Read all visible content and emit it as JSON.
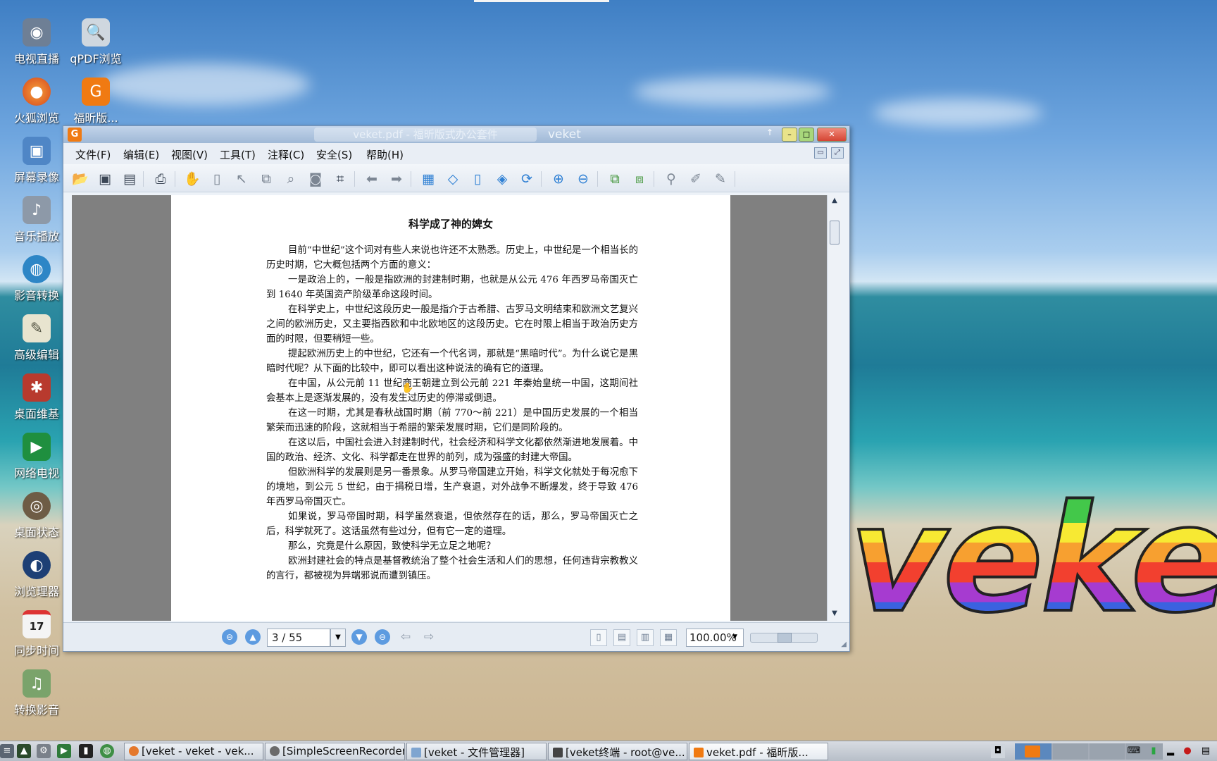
{
  "desktop": {
    "icons": [
      {
        "label": "电视直播",
        "glyph": "◉"
      },
      {
        "label": "qPDF浏览",
        "glyph": "🔍"
      },
      {
        "label": "火狐浏览",
        "glyph": "●"
      },
      {
        "label": "福昕版...",
        "glyph": "G"
      },
      {
        "label": "屏幕录像",
        "glyph": "▣"
      },
      {
        "label": "音乐播放",
        "glyph": "♪"
      },
      {
        "label": "影音转换",
        "glyph": "◍"
      },
      {
        "label": "高级编辑",
        "glyph": "✎"
      },
      {
        "label": "桌面维基",
        "glyph": "✱"
      },
      {
        "label": "网络电视",
        "glyph": "▶"
      },
      {
        "label": "桌面状态",
        "glyph": "◎"
      },
      {
        "label": "浏览理器",
        "glyph": "◐"
      },
      {
        "label": "同步时间",
        "glyph": "17"
      },
      {
        "label": "转换影音",
        "glyph": "♫"
      }
    ],
    "logo_text": "veket"
  },
  "window": {
    "title": "veket.pdf - 福昕版式办公套件",
    "subtitle": "veket",
    "menu": [
      "文件(F)",
      "编辑(E)",
      "视图(V)",
      "工具(T)",
      "注释(C)",
      "安全(S)",
      "帮助(H)"
    ]
  },
  "document": {
    "heading": "科学成了神的婢女",
    "paragraphs": [
      "目前“中世纪”这个词对有些人来说也许还不太熟悉。历史上，中世纪是一个相当长的历史时期，它大概包括两个方面的意义：",
      "一是政治上的，一般是指欧洲的封建制时期，也就是从公元 476 年西罗马帝国灭亡到 1640 年英国资产阶级革命这段时间。",
      "在科学史上，中世纪这段历史一般是指介于古希腊、古罗马文明结束和欧洲文艺复兴之间的欧洲历史，又主要指西欧和中北欧地区的这段历史。它在时限上相当于政治历史方面的时限，但要稍短一些。",
      "提起欧洲历史上的中世纪，它还有一个代名词，那就是“黑暗时代”。为什么说它是黑暗时代呢？从下面的比较中，即可以看出这种说法的确有它的道理。",
      "在中国，从公元前 11 世纪商王朝建立到公元前 221 年秦始皇统一中国，这期间社会基本上是逐渐发展的，没有发生过历史的停滞或倒退。",
      "在这一时期，尤其是春秋战国时期（前 770～前 221）是中国历史发展的一个相当繁荣而迅速的阶段，这就相当于希腊的繁荣发展时期，它们是同阶段的。",
      "在这以后，中国社会进入封建制时代，社会经济和科学文化都依然渐进地发展着。中国的政治、经济、文化、科学都走在世界的前列，成为强盛的封建大帝国。",
      "但欧洲科学的发展则是另一番景象。从罗马帝国建立开始，科学文化就处于每况愈下的境地，到公元 5 世纪，由于捐税日增，生产衰退，对外战争不断爆发，终于导致 476 年西罗马帝国灭亡。",
      "如果说，罗马帝国时期，科学虽然衰退，但依然存在的话，那么，罗马帝国灭亡之后，科学就死了。这话虽然有些过分，但有它一定的道理。",
      "那么，究竟是什么原因，致使科学无立足之地呢？",
      "欧洲封建社会的特点是基督教统治了整个社会生活和人们的思想，任何违背宗教教义的言行，都被视为异端邪说而遭到镇压。"
    ]
  },
  "status": {
    "page_indicator": "3 / 55",
    "zoom": "100.00%"
  },
  "taskbar": {
    "tasks": [
      "[veket - veket - vek...",
      "[SimpleScreenRecorder]",
      "[veket - 文件管理器]",
      "[veket终端 - root@ve...",
      "veket.pdf - 福昕版..."
    ]
  }
}
